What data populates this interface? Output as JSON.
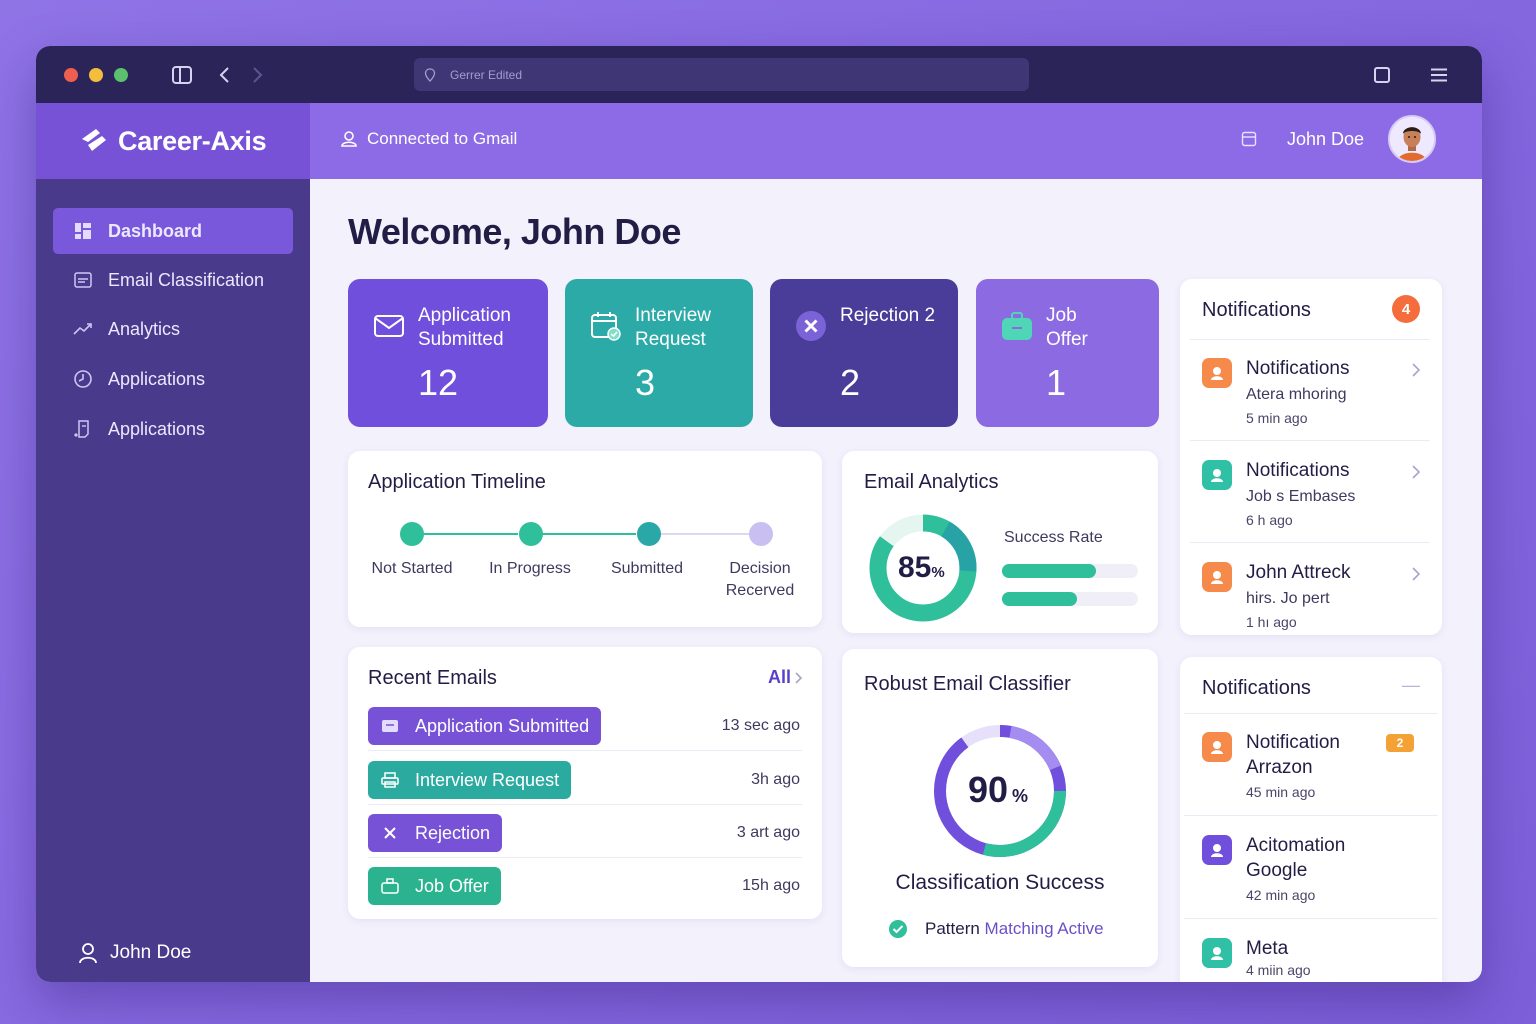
{
  "browser": {
    "url_text": "Gerrer Edited"
  },
  "header": {
    "brand": "Career-Axis",
    "gmail_status": "Connected to Gmail",
    "user_name": "John Doe"
  },
  "sidebar": {
    "items": [
      {
        "label": "Dashboard",
        "icon": "grid-icon",
        "active": true
      },
      {
        "label": "Email Classification",
        "icon": "inbox-icon"
      },
      {
        "label": "Analytics",
        "icon": "trend-icon"
      },
      {
        "label": "Applications",
        "icon": "clock-icon"
      },
      {
        "label": "Applications",
        "icon": "document-icon"
      }
    ],
    "user": "John Doe"
  },
  "main": {
    "welcome": "Welcome, John Doe",
    "stats": [
      {
        "label": "Application Submitted",
        "value": "12",
        "color": "#6f4fdb",
        "icon": "envelope-icon"
      },
      {
        "label": "Interview Request",
        "value": "3",
        "color": "#2baaa8",
        "icon": "calendar-icon"
      },
      {
        "label": "Rejection 2",
        "value": "2",
        "color": "#4a3d9a",
        "icon": "x-circle-icon"
      },
      {
        "label": "Job Offer",
        "value": "1",
        "color": "#8c6ae2",
        "icon": "briefcase-icon"
      }
    ],
    "timeline": {
      "title": "Application Timeline",
      "steps": [
        "Not Started",
        "In Progress",
        "Submitted",
        "Decision Recerved"
      ]
    },
    "email_analytics": {
      "title": "Email Analytics",
      "percent": "85",
      "percent_unit": "%",
      "rate_label": "Success Rate",
      "bar1_fraction": 0.69,
      "bar2_fraction": 0.55
    },
    "recent_emails": {
      "title": "Recent Emails",
      "all_link": "All",
      "rows": [
        {
          "label": "Application Submitted",
          "time": "13 sec  ago",
          "color": "#7752d6",
          "icon": "inbox-icon"
        },
        {
          "label": "Interview Request",
          "time": "3h  ago",
          "color": "#2baaa0",
          "icon": "printer-icon"
        },
        {
          "label": "Rejection",
          "time": "3 art ago",
          "color": "#7752d6",
          "icon": "x-icon"
        },
        {
          "label": "Job Offer",
          "time": "15h  ago",
          "color": "#2bb38f",
          "icon": "briefcase-icon"
        }
      ]
    },
    "classifier": {
      "title": "Robust Email Classifier",
      "percent": "90",
      "percent_unit": "%",
      "caption": "Classification Success",
      "status_prefix": "Pattern",
      "status_suffix": "Matching Active"
    },
    "notifications_top": {
      "title": "Notifications",
      "badge": "4",
      "items": [
        {
          "title": "Notifications",
          "sub": "Atera mhoring",
          "time": "5 min ago",
          "color": "#f58a4b"
        },
        {
          "title": "Notifications",
          "sub": "Job s Embases",
          "time": "6 h ago",
          "color": "#2fc0a6"
        },
        {
          "title": "John Attreck",
          "sub": "hirs. Jo pert",
          "time": "1 hı ago",
          "color": "#f58a4b"
        }
      ]
    },
    "notifications_bottom": {
      "title": "Notifications",
      "collapse": "—",
      "items": [
        {
          "title": "Notification Arrazon",
          "badge": "2",
          "time": "45 min ago",
          "color": "#f58a4b"
        },
        {
          "title": "Acitomation Google",
          "time": "42 min ago",
          "color": "#6f4fdb"
        },
        {
          "title": "Meta",
          "time": "4 miin  ago",
          "color": "#2fc0a6"
        }
      ]
    }
  }
}
